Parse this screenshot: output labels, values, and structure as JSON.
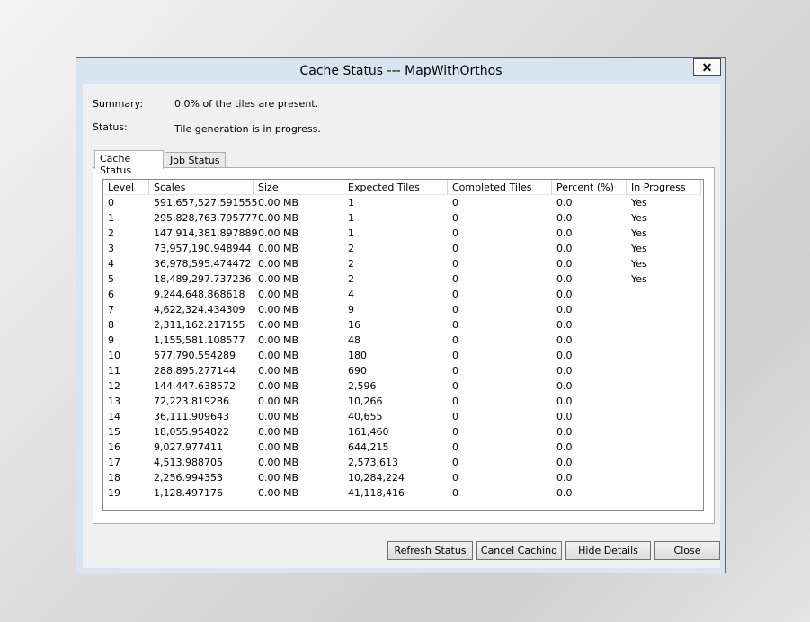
{
  "window": {
    "title": "Cache Status --- MapWithOrthos",
    "close_glyph": "✕"
  },
  "summary": {
    "label": "Summary:",
    "value": "0.0% of the tiles are present."
  },
  "status": {
    "label": "Status:",
    "value": "Tile generation is in progress."
  },
  "tabs": [
    {
      "label": "Cache Status",
      "active": true
    },
    {
      "label": "Job Status",
      "active": false
    }
  ],
  "table": {
    "columns": [
      "Level",
      "Scales",
      "Size",
      "Expected Tiles",
      "Completed Tiles",
      "Percent (%)",
      "In Progress"
    ],
    "rows": [
      [
        "0",
        "591,657,527.591555",
        "0.00 MB",
        "1",
        "0",
        "0.0",
        "Yes"
      ],
      [
        "1",
        "295,828,763.795777",
        "0.00 MB",
        "1",
        "0",
        "0.0",
        "Yes"
      ],
      [
        "2",
        "147,914,381.897889",
        "0.00 MB",
        "1",
        "0",
        "0.0",
        "Yes"
      ],
      [
        "3",
        "73,957,190.948944",
        "0.00 MB",
        "2",
        "0",
        "0.0",
        "Yes"
      ],
      [
        "4",
        "36,978,595.474472",
        "0.00 MB",
        "2",
        "0",
        "0.0",
        "Yes"
      ],
      [
        "5",
        "18,489,297.737236",
        "0.00 MB",
        "2",
        "0",
        "0.0",
        "Yes"
      ],
      [
        "6",
        "9,244,648.868618",
        "0.00 MB",
        "4",
        "0",
        "0.0",
        ""
      ],
      [
        "7",
        "4,622,324.434309",
        "0.00 MB",
        "9",
        "0",
        "0.0",
        ""
      ],
      [
        "8",
        "2,311,162.217155",
        "0.00 MB",
        "16",
        "0",
        "0.0",
        ""
      ],
      [
        "9",
        "1,155,581.108577",
        "0.00 MB",
        "48",
        "0",
        "0.0",
        ""
      ],
      [
        "10",
        "577,790.554289",
        "0.00 MB",
        "180",
        "0",
        "0.0",
        ""
      ],
      [
        "11",
        "288,895.277144",
        "0.00 MB",
        "690",
        "0",
        "0.0",
        ""
      ],
      [
        "12",
        "144,447.638572",
        "0.00 MB",
        "2,596",
        "0",
        "0.0",
        ""
      ],
      [
        "13",
        "72,223.819286",
        "0.00 MB",
        "10,266",
        "0",
        "0.0",
        ""
      ],
      [
        "14",
        "36,111.909643",
        "0.00 MB",
        "40,655",
        "0",
        "0.0",
        ""
      ],
      [
        "15",
        "18,055.954822",
        "0.00 MB",
        "161,460",
        "0",
        "0.0",
        ""
      ],
      [
        "16",
        "9,027.977411",
        "0.00 MB",
        "644,215",
        "0",
        "0.0",
        ""
      ],
      [
        "17",
        "4,513.988705",
        "0.00 MB",
        "2,573,613",
        "0",
        "0.0",
        ""
      ],
      [
        "18",
        "2,256.994353",
        "0.00 MB",
        "10,284,224",
        "0",
        "0.0",
        ""
      ],
      [
        "19",
        "1,128.497176",
        "0.00 MB",
        "41,118,416",
        "0",
        "0.0",
        ""
      ]
    ]
  },
  "buttons": {
    "refresh": "Refresh Status",
    "cancel": "Cancel Caching",
    "hide": "Hide Details",
    "close": "Close"
  }
}
